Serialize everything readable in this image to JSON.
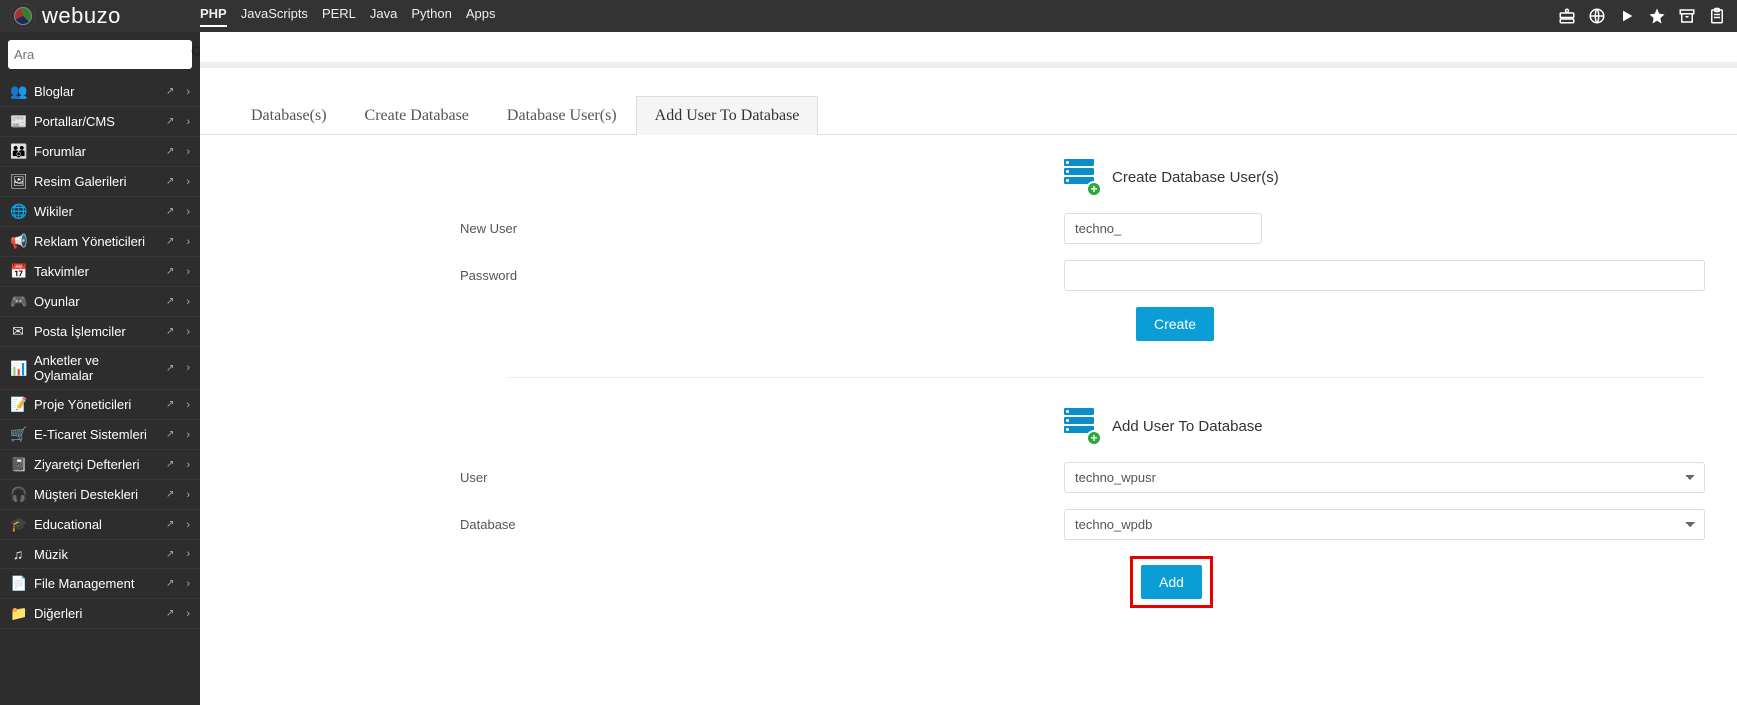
{
  "brand": "webuzo",
  "topnav": [
    {
      "label": "PHP",
      "active": true
    },
    {
      "label": "JavaScripts"
    },
    {
      "label": "PERL"
    },
    {
      "label": "Java"
    },
    {
      "label": "Python"
    },
    {
      "label": "Apps"
    }
  ],
  "search": {
    "placeholder": "Ara"
  },
  "sidebar": [
    {
      "icon": "👥",
      "label": "Bloglar"
    },
    {
      "icon": "📰",
      "label": "Portallar/CMS"
    },
    {
      "icon": "👪",
      "label": "Forumlar"
    },
    {
      "icon": "🖼",
      "label": "Resim Galerileri"
    },
    {
      "icon": "🌐",
      "label": "Wikiler"
    },
    {
      "icon": "📢",
      "label": "Reklam Yöneticileri"
    },
    {
      "icon": "📅",
      "label": "Takvimler"
    },
    {
      "icon": "🎮",
      "label": "Oyunlar"
    },
    {
      "icon": "✉",
      "label": "Posta İşlemciler"
    },
    {
      "icon": "📊",
      "label": "Anketler ve Oylamalar"
    },
    {
      "icon": "📝",
      "label": "Proje Yöneticileri"
    },
    {
      "icon": "🛒",
      "label": "E-Ticaret Sistemleri"
    },
    {
      "icon": "📓",
      "label": "Ziyaretçi Defterleri"
    },
    {
      "icon": "🎧",
      "label": "Müşteri Destekleri"
    },
    {
      "icon": "🎓",
      "label": "Educational"
    },
    {
      "icon": "♫",
      "label": "Müzik"
    },
    {
      "icon": "📄",
      "label": "File Management"
    },
    {
      "icon": "📁",
      "label": "Diğerleri"
    }
  ],
  "tabs": [
    {
      "label": "Database(s)"
    },
    {
      "label": "Create Database"
    },
    {
      "label": "Database User(s)"
    },
    {
      "label": "Add User To Database",
      "active": true
    }
  ],
  "section1": {
    "title": "Create Database User(s)",
    "newUserLabel": "New User",
    "newUserValue": "techno_",
    "passwordLabel": "Password",
    "passwordValue": "",
    "createBtn": "Create"
  },
  "section2": {
    "title": "Add User To Database",
    "userLabel": "User",
    "userValue": "techno_wpusr",
    "dbLabel": "Database",
    "dbValue": "techno_wpdb",
    "addBtn": "Add"
  },
  "extIcon": "↗"
}
